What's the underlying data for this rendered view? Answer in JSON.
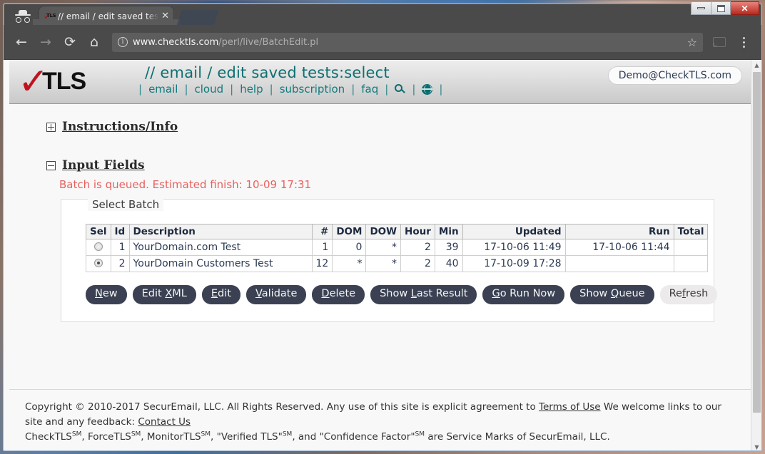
{
  "browser": {
    "window_controls": {
      "minimize": "—",
      "maximize": "❐",
      "close": "✕"
    },
    "incognito_icon": "incognito-icon",
    "tab": {
      "favicon": "checktls-favicon",
      "favicon_check": "✓",
      "favicon_text": "TLS",
      "title": "// email / edit saved tests:select",
      "close_label": "✕"
    },
    "toolbar": {
      "back_label": "←",
      "forward_label": "→",
      "reload_label": "⟳",
      "home_label": "⌂",
      "url_host": "www.checktls.com",
      "url_path": "/perl/live/BatchEdit.pl",
      "info_icon_label": "i",
      "star_label": "☆",
      "cast_icon": "cast-icon",
      "menu_icon": "kebab-menu-icon"
    }
  },
  "site": {
    "logo": {
      "check": "✓",
      "word": "TLS"
    },
    "page_title": "// email / edit saved tests:select",
    "user_badge": "Demo@CheckTLS.com",
    "nav": [
      {
        "label": "email",
        "type": "text"
      },
      {
        "label": "cloud",
        "type": "text"
      },
      {
        "label": "help",
        "type": "text"
      },
      {
        "label": "subscription",
        "type": "text"
      },
      {
        "label": "faq",
        "type": "text"
      },
      {
        "label": "search-icon",
        "type": "icon"
      },
      {
        "label": "globe-icon",
        "type": "icon"
      }
    ],
    "nav_separator": "|"
  },
  "content": {
    "instructions_section": {
      "label": "Instructions/Info",
      "toggle": "expand"
    },
    "input_fields_section": {
      "label": "Input Fields",
      "toggle": "collapse"
    },
    "queued_message": "Batch is queued. Estimated finish: 10-09 17:31",
    "panel_legend": "Select Batch",
    "table": {
      "headers": [
        "Sel",
        "Id",
        "Description",
        "#",
        "DOM",
        "DOW",
        "Hour",
        "Min",
        "Updated",
        "Run",
        "Total"
      ],
      "rows": [
        {
          "selected": false,
          "id": "1",
          "description": "YourDomain.com Test",
          "count": "1",
          "dom": "0",
          "dow": "*",
          "hour": "2",
          "min": "39",
          "updated": "17-10-06 11:49",
          "run": "17-10-06 11:44",
          "total": ""
        },
        {
          "selected": true,
          "id": "2",
          "description": "YourDomain Customers Test",
          "count": "12",
          "dom": "*",
          "dow": "*",
          "hour": "2",
          "min": "40",
          "updated": "17-10-09 17:28",
          "run": "",
          "total": ""
        }
      ]
    },
    "buttons": [
      {
        "pre": "",
        "accel": "N",
        "post": "ew",
        "style": "dark",
        "name": "new-button"
      },
      {
        "pre": "Edit ",
        "accel": "X",
        "post": "ML",
        "style": "dark",
        "name": "edit-xml-button"
      },
      {
        "pre": "",
        "accel": "E",
        "post": "dit",
        "style": "dark",
        "name": "edit-button"
      },
      {
        "pre": "",
        "accel": "V",
        "post": "alidate",
        "style": "dark",
        "name": "validate-button"
      },
      {
        "pre": "",
        "accel": "D",
        "post": "elete",
        "style": "dark",
        "name": "delete-button"
      },
      {
        "pre": "Show ",
        "accel": "L",
        "post": "ast Result",
        "style": "dark",
        "name": "show-last-result-button"
      },
      {
        "pre": "",
        "accel": "G",
        "post": "o Run Now",
        "style": "dark",
        "name": "go-run-now-button"
      },
      {
        "pre": "Show ",
        "accel": "Q",
        "post": "ueue",
        "style": "dark",
        "name": "show-queue-button"
      },
      {
        "pre": "Re",
        "accel": "f",
        "post": "resh",
        "style": "light",
        "name": "refresh-button"
      }
    ]
  },
  "footer": {
    "line1_a": "Copyright © 2010-2017 SecurEmail, LLC. All Rights Reserved. Any use of this site is explicit agreement to ",
    "terms_link": "Terms of Use",
    "line1_b": " We welcome links to our site and any feedback: ",
    "contact_link": "Contact Us",
    "line2_a": "CheckTLS",
    "sm1": "SM",
    "line2_b": ", ForceTLS",
    "sm2": "SM",
    "line2_c": ", MonitorTLS",
    "sm3": "SM",
    "line2_d": ", \"Verified TLS\"",
    "sm4": "SM",
    "line2_e": ", and \"Confidence Factor\"",
    "sm5": "SM",
    "line2_f": " are Service Marks of SecurEmail, LLC."
  },
  "scrollbar": {
    "up": "▲",
    "down": "▼"
  },
  "colors": {
    "accent_teal": "#127a7d",
    "alert_red": "#e8615e",
    "button_dark": "#3b4152",
    "logo_red": "#c1121f"
  }
}
